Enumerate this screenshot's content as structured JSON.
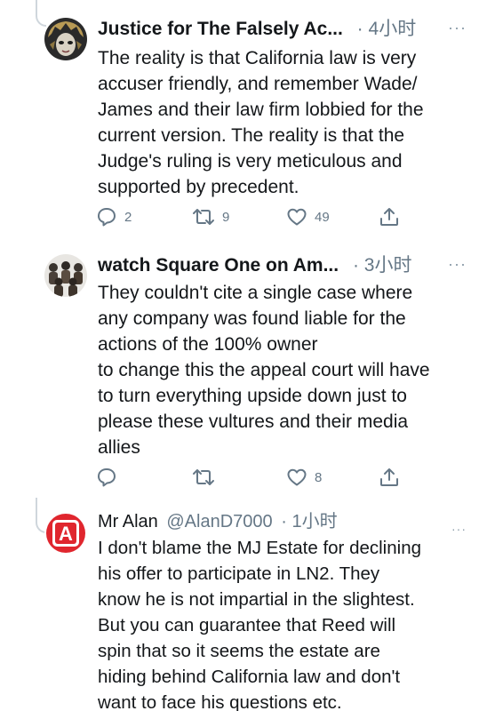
{
  "tweets": [
    {
      "name": "Justice for The Falsely Ac...",
      "handle": "",
      "separator": "·",
      "time": "4小时",
      "more": "···",
      "avatar_icon": "masked-face-avatar",
      "text_lines": [
        "The reality is that California law is very",
        "accuser friendly, and remember Wade/",
        "James and their law firm lobbied for the",
        "current version. The reality is that the",
        "Judge's ruling is very meticulous and",
        "supported by precedent."
      ],
      "reply_count": "2",
      "retweet_count": "9",
      "like_count": "49"
    },
    {
      "name": "watch Square One on Am...",
      "handle": "",
      "separator": "·",
      "time": "3小时",
      "more": "···",
      "avatar_icon": "group-photo-avatar",
      "text_lines": [
        "They couldn't cite a single case where",
        "any company was found liable for the",
        "actions of the 100% owner",
        "to change this the appeal court will have",
        "to turn everything upside down just to",
        "please these vultures and their media",
        "allies"
      ],
      "reply_count": "",
      "retweet_count": "",
      "like_count": "8"
    },
    {
      "name": "Mr Alan",
      "handle": "@AlanD7000",
      "separator": "·",
      "time": "1小时",
      "more": "···",
      "avatar_icon": "red-letter-a-avatar",
      "avatar_letter": "A",
      "text_lines": [
        "I don't blame the MJ Estate for declining",
        "his offer to participate in LN2. They",
        "know he is not impartial in the slightest.",
        "But you can guarantee that Reed will",
        "spin that so it seems the estate are",
        "hiding behind California law and don't",
        "want to face his questions etc."
      ]
    }
  ],
  "colors": {
    "text": "#14171a",
    "secondary": "#657786",
    "thread_line": "#cfd6dc",
    "brand_red": "#e0262e"
  }
}
